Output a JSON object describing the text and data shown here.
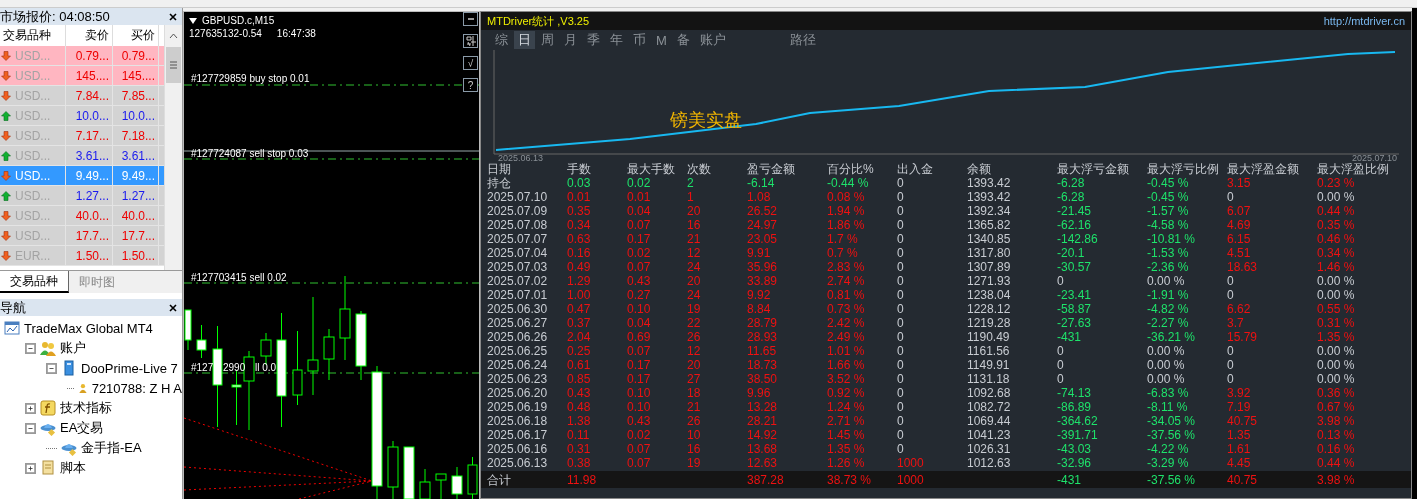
{
  "market_watch": {
    "title": "市场报价: 04:08:50",
    "columns": [
      "交易品种",
      "卖价",
      "买价"
    ],
    "rows": [
      {
        "symbol": "USD...",
        "bid": "0.79...",
        "ask": "0.79...",
        "rising": false,
        "highlighted": true,
        "selected": false
      },
      {
        "symbol": "USD...",
        "bid": "145....",
        "ask": "145....",
        "rising": false,
        "highlighted": true,
        "selected": false
      },
      {
        "symbol": "USD...",
        "bid": "7.84...",
        "ask": "7.85...",
        "rising": false,
        "highlighted": false,
        "selected": false
      },
      {
        "symbol": "USD...",
        "bid": "10.0...",
        "ask": "10.0...",
        "rising": true,
        "highlighted": false,
        "selected": false
      },
      {
        "symbol": "USD...",
        "bid": "7.17...",
        "ask": "7.18...",
        "rising": false,
        "highlighted": false,
        "selected": false
      },
      {
        "symbol": "USD...",
        "bid": "3.61...",
        "ask": "3.61...",
        "rising": true,
        "highlighted": false,
        "selected": false
      },
      {
        "symbol": "USD...",
        "bid": "9.49...",
        "ask": "9.49...",
        "rising": false,
        "highlighted": false,
        "selected": true
      },
      {
        "symbol": "USD...",
        "bid": "1.27...",
        "ask": "1.27...",
        "rising": true,
        "highlighted": false,
        "selected": false
      },
      {
        "symbol": "USD...",
        "bid": "40.0...",
        "ask": "40.0...",
        "rising": false,
        "highlighted": false,
        "selected": false
      },
      {
        "symbol": "USD...",
        "bid": "17.7...",
        "ask": "17.7...",
        "rising": false,
        "highlighted": false,
        "selected": false
      },
      {
        "symbol": "EUR...",
        "bid": "1.50...",
        "ask": "1.50...",
        "rising": false,
        "highlighted": false,
        "selected": false
      }
    ],
    "tabs": [
      {
        "label": "交易品种",
        "selected": true
      },
      {
        "label": "即时图",
        "selected": false
      }
    ]
  },
  "navigator": {
    "title": "导航",
    "tree": [
      {
        "label": "TradeMax Global MT4",
        "kind": "terminal",
        "children": [
          {
            "label": "账户",
            "kind": "accounts",
            "expanded": true,
            "children": [
              {
                "label": "DooPrime-Live 7",
                "kind": "server",
                "expanded": true,
                "children": [
                  {
                    "label": "7210788: Z H A",
                    "kind": "account"
                  }
                ]
              }
            ]
          },
          {
            "label": "技术指标",
            "kind": "indicators",
            "expanded": false
          },
          {
            "label": "EA交易",
            "kind": "experts",
            "expanded": true,
            "children": [
              {
                "label": "金手指-EA",
                "kind": "expert"
              }
            ]
          },
          {
            "label": "脚本",
            "kind": "scripts",
            "expanded": false
          }
        ]
      }
    ]
  },
  "chart": {
    "symbol": "GBPUSD.c,M15",
    "info": [
      "127635132-0.54",
      "16:47:38"
    ],
    "buttons": [
      "√",
      "?"
    ],
    "orders": [
      {
        "parts": [
          "#127729859 buy stop 0.01"
        ]
      },
      {
        "parts": [
          "#127724087 sell stop 0.03"
        ]
      },
      {
        "parts": [
          "#127703415 sell 0.02"
        ]
      },
      {
        "parts": [
          "#127",
          "2990",
          "ll 0.0"
        ]
      }
    ]
  },
  "stats": {
    "title": "MTDriver统计 ,V3.25",
    "link": "http://mtdriver.cn",
    "tabs": [
      {
        "label": "综",
        "selected": false
      },
      {
        "label": "日",
        "selected": true
      },
      {
        "label": "周",
        "selected": false
      },
      {
        "label": "月",
        "selected": false
      },
      {
        "label": "季",
        "selected": false
      },
      {
        "label": "年",
        "selected": false
      },
      {
        "label": "币",
        "selected": false
      },
      {
        "label": "M",
        "selected": false
      },
      {
        "label": "备",
        "selected": false
      },
      {
        "label": "账户",
        "selected": false
      },
      {
        "label": "路径",
        "selected": false
      }
    ],
    "equity": {
      "label": "镑美实盘",
      "start": "2025.06.13",
      "end": "2025.07.10"
    },
    "columns": [
      "日期",
      "手数",
      "最大手数",
      "次数",
      "盈亏金额",
      "百分比%",
      "出入金",
      "余额",
      "最大浮亏金额",
      "最大浮亏比例",
      "最大浮盈金额",
      "最大浮盈比例"
    ],
    "rows": [
      [
        {
          "text": "持仓"
        },
        {
          "text": "0.03",
          "color": "#1ee36b"
        },
        {
          "text": "0.02",
          "color": "#1ee36b"
        },
        {
          "text": "2",
          "color": "#1ee36b"
        },
        {
          "text": "-6.14",
          "color": "#1ee36b"
        },
        {
          "text": "-0.44 %",
          "color": "#1ee36b"
        },
        {
          "text": "0",
          "color": "#c8ccd2"
        },
        {
          "text": "1393.42",
          "color": "#c8ccd2"
        },
        {
          "text": "-6.28",
          "color": "#1ee36b"
        },
        {
          "text": "-0.45 %",
          "color": "#1ee36b"
        },
        {
          "text": "3.15",
          "color": "#ee1111"
        },
        {
          "text": "0.23 %",
          "color": "#ee1111"
        }
      ],
      [
        {
          "text": "2025.07.10",
          "color": "#c8ccd2"
        },
        {
          "text": "0.01",
          "color": "#ee1111"
        },
        {
          "text": "0.01",
          "color": "#ee1111"
        },
        {
          "text": "1",
          "color": "#ee1111"
        },
        {
          "text": "1.08",
          "color": "#ee1111"
        },
        {
          "text": "0.08 %",
          "color": "#ee1111"
        },
        {
          "text": "0",
          "color": "#c8ccd2"
        },
        {
          "text": "1393.42",
          "color": "#c8ccd2"
        },
        {
          "text": "-6.28",
          "color": "#1ee36b"
        },
        {
          "text": "-0.45 %",
          "color": "#1ee36b"
        },
        {
          "text": "0",
          "color": "#c8ccd2"
        },
        {
          "text": "0.00 %",
          "color": "#c8ccd2"
        }
      ],
      [
        {
          "text": "2025.07.09",
          "color": "#c8ccd2"
        },
        {
          "text": "0.35",
          "color": "#ee1111"
        },
        {
          "text": "0.04",
          "color": "#ee1111"
        },
        {
          "text": "20",
          "color": "#ee1111"
        },
        {
          "text": "26.52",
          "color": "#ee1111"
        },
        {
          "text": "1.94 %",
          "color": "#ee1111"
        },
        {
          "text": "0",
          "color": "#c8ccd2"
        },
        {
          "text": "1392.34",
          "color": "#c8ccd2"
        },
        {
          "text": "-21.45",
          "color": "#1ee36b"
        },
        {
          "text": "-1.57 %",
          "color": "#1ee36b"
        },
        {
          "text": "6.07",
          "color": "#ee1111"
        },
        {
          "text": "0.44 %",
          "color": "#ee1111"
        }
      ],
      [
        {
          "text": "2025.07.08",
          "color": "#c8ccd2"
        },
        {
          "text": "0.34",
          "color": "#ee1111"
        },
        {
          "text": "0.07",
          "color": "#ee1111"
        },
        {
          "text": "16",
          "color": "#ee1111"
        },
        {
          "text": "24.97",
          "color": "#ee1111"
        },
        {
          "text": "1.86 %",
          "color": "#ee1111"
        },
        {
          "text": "0",
          "color": "#c8ccd2"
        },
        {
          "text": "1365.82",
          "color": "#c8ccd2"
        },
        {
          "text": "-62.16",
          "color": "#1ee36b"
        },
        {
          "text": "-4.58 %",
          "color": "#1ee36b"
        },
        {
          "text": "4.69",
          "color": "#ee1111"
        },
        {
          "text": "0.35 %",
          "color": "#ee1111"
        }
      ],
      [
        {
          "text": "2025.07.07",
          "color": "#c8ccd2"
        },
        {
          "text": "0.63",
          "color": "#ee1111"
        },
        {
          "text": "0.17",
          "color": "#ee1111"
        },
        {
          "text": "21",
          "color": "#ee1111"
        },
        {
          "text": "23.05",
          "color": "#ee1111"
        },
        {
          "text": "1.7 %",
          "color": "#ee1111"
        },
        {
          "text": "0",
          "color": "#c8ccd2"
        },
        {
          "text": "1340.85",
          "color": "#c8ccd2"
        },
        {
          "text": "-142.86",
          "color": "#1ee36b"
        },
        {
          "text": "-10.81 %",
          "color": "#1ee36b"
        },
        {
          "text": "6.15",
          "color": "#ee1111"
        },
        {
          "text": "0.46 %",
          "color": "#ee1111"
        }
      ],
      [
        {
          "text": "2025.07.04",
          "color": "#c8ccd2"
        },
        {
          "text": "0.16",
          "color": "#ee1111"
        },
        {
          "text": "0.02",
          "color": "#ee1111"
        },
        {
          "text": "12",
          "color": "#ee1111"
        },
        {
          "text": "9.91",
          "color": "#ee1111"
        },
        {
          "text": "0.7 %",
          "color": "#ee1111"
        },
        {
          "text": "0",
          "color": "#c8ccd2"
        },
        {
          "text": "1317.80",
          "color": "#c8ccd2"
        },
        {
          "text": "-20.1",
          "color": "#1ee36b"
        },
        {
          "text": "-1.53 %",
          "color": "#1ee36b"
        },
        {
          "text": "4.51",
          "color": "#ee1111"
        },
        {
          "text": "0.34 %",
          "color": "#ee1111"
        }
      ],
      [
        {
          "text": "2025.07.03",
          "color": "#c8ccd2"
        },
        {
          "text": "0.49",
          "color": "#ee1111"
        },
        {
          "text": "0.07",
          "color": "#ee1111"
        },
        {
          "text": "24",
          "color": "#ee1111"
        },
        {
          "text": "35.96",
          "color": "#ee1111"
        },
        {
          "text": "2.83 %",
          "color": "#ee1111"
        },
        {
          "text": "0",
          "color": "#c8ccd2"
        },
        {
          "text": "1307.89",
          "color": "#c8ccd2"
        },
        {
          "text": "-30.57",
          "color": "#1ee36b"
        },
        {
          "text": "-2.36 %",
          "color": "#1ee36b"
        },
        {
          "text": "18.63",
          "color": "#ee1111"
        },
        {
          "text": "1.46 %",
          "color": "#ee1111"
        }
      ],
      [
        {
          "text": "2025.07.02",
          "color": "#c8ccd2"
        },
        {
          "text": "1.29",
          "color": "#ee1111"
        },
        {
          "text": "0.43",
          "color": "#ee1111"
        },
        {
          "text": "20",
          "color": "#ee1111"
        },
        {
          "text": "33.89",
          "color": "#ee1111"
        },
        {
          "text": "2.74 %",
          "color": "#ee1111"
        },
        {
          "text": "0",
          "color": "#c8ccd2"
        },
        {
          "text": "1271.93",
          "color": "#c8ccd2"
        },
        {
          "text": "0",
          "color": "#c8ccd2"
        },
        {
          "text": "0.00 %",
          "color": "#c8ccd2"
        },
        {
          "text": "0",
          "color": "#c8ccd2"
        },
        {
          "text": "0.00 %",
          "color": "#c8ccd2"
        }
      ],
      [
        {
          "text": "2025.07.01",
          "color": "#c8ccd2"
        },
        {
          "text": "1.00",
          "color": "#ee1111"
        },
        {
          "text": "0.27",
          "color": "#ee1111"
        },
        {
          "text": "24",
          "color": "#ee1111"
        },
        {
          "text": "9.92",
          "color": "#ee1111"
        },
        {
          "text": "0.81 %",
          "color": "#ee1111"
        },
        {
          "text": "0",
          "color": "#c8ccd2"
        },
        {
          "text": "1238.04",
          "color": "#c8ccd2"
        },
        {
          "text": "-23.41",
          "color": "#1ee36b"
        },
        {
          "text": "-1.91 %",
          "color": "#1ee36b"
        },
        {
          "text": "0",
          "color": "#c8ccd2"
        },
        {
          "text": "0.00 %",
          "color": "#c8ccd2"
        }
      ],
      [
        {
          "text": "2025.06.30",
          "color": "#c8ccd2"
        },
        {
          "text": "0.47",
          "color": "#ee1111"
        },
        {
          "text": "0.10",
          "color": "#ee1111"
        },
        {
          "text": "19",
          "color": "#ee1111"
        },
        {
          "text": "8.84",
          "color": "#ee1111"
        },
        {
          "text": "0.73 %",
          "color": "#ee1111"
        },
        {
          "text": "0",
          "color": "#c8ccd2"
        },
        {
          "text": "1228.12",
          "color": "#c8ccd2"
        },
        {
          "text": "-58.87",
          "color": "#1ee36b"
        },
        {
          "text": "-4.82 %",
          "color": "#1ee36b"
        },
        {
          "text": "6.62",
          "color": "#ee1111"
        },
        {
          "text": "0.55 %",
          "color": "#ee1111"
        }
      ],
      [
        {
          "text": "2025.06.27",
          "color": "#c8ccd2"
        },
        {
          "text": "0.37",
          "color": "#ee1111"
        },
        {
          "text": "0.04",
          "color": "#ee1111"
        },
        {
          "text": "22",
          "color": "#ee1111"
        },
        {
          "text": "28.79",
          "color": "#ee1111"
        },
        {
          "text": "2.42 %",
          "color": "#ee1111"
        },
        {
          "text": "0",
          "color": "#c8ccd2"
        },
        {
          "text": "1219.28",
          "color": "#c8ccd2"
        },
        {
          "text": "-27.63",
          "color": "#1ee36b"
        },
        {
          "text": "-2.27 %",
          "color": "#1ee36b"
        },
        {
          "text": "3.7",
          "color": "#ee1111"
        },
        {
          "text": "0.31 %",
          "color": "#ee1111"
        }
      ],
      [
        {
          "text": "2025.06.26",
          "color": "#c8ccd2"
        },
        {
          "text": "2.04",
          "color": "#ee1111"
        },
        {
          "text": "0.69",
          "color": "#ee1111"
        },
        {
          "text": "26",
          "color": "#ee1111"
        },
        {
          "text": "28.93",
          "color": "#ee1111"
        },
        {
          "text": "2.49 %",
          "color": "#ee1111"
        },
        {
          "text": "0",
          "color": "#c8ccd2"
        },
        {
          "text": "1190.49",
          "color": "#c8ccd2"
        },
        {
          "text": "-431",
          "color": "#1ee36b"
        },
        {
          "text": "-36.21 %",
          "color": "#1ee36b"
        },
        {
          "text": "15.79",
          "color": "#ee1111"
        },
        {
          "text": "1.35 %",
          "color": "#ee1111"
        }
      ],
      [
        {
          "text": "2025.06.25",
          "color": "#c8ccd2"
        },
        {
          "text": "0.25",
          "color": "#ee1111"
        },
        {
          "text": "0.07",
          "color": "#ee1111"
        },
        {
          "text": "12",
          "color": "#ee1111"
        },
        {
          "text": "11.65",
          "color": "#ee1111"
        },
        {
          "text": "1.01 %",
          "color": "#ee1111"
        },
        {
          "text": "0",
          "color": "#c8ccd2"
        },
        {
          "text": "1161.56",
          "color": "#c8ccd2"
        },
        {
          "text": "0",
          "color": "#c8ccd2"
        },
        {
          "text": "0.00 %",
          "color": "#c8ccd2"
        },
        {
          "text": "0",
          "color": "#c8ccd2"
        },
        {
          "text": "0.00 %",
          "color": "#c8ccd2"
        }
      ],
      [
        {
          "text": "2025.06.24",
          "color": "#c8ccd2"
        },
        {
          "text": "0.61",
          "color": "#ee1111"
        },
        {
          "text": "0.17",
          "color": "#ee1111"
        },
        {
          "text": "20",
          "color": "#ee1111"
        },
        {
          "text": "18.73",
          "color": "#ee1111"
        },
        {
          "text": "1.66 %",
          "color": "#ee1111"
        },
        {
          "text": "0",
          "color": "#c8ccd2"
        },
        {
          "text": "1149.91",
          "color": "#c8ccd2"
        },
        {
          "text": "0",
          "color": "#c8ccd2"
        },
        {
          "text": "0.00 %",
          "color": "#c8ccd2"
        },
        {
          "text": "0",
          "color": "#c8ccd2"
        },
        {
          "text": "0.00 %",
          "color": "#c8ccd2"
        }
      ],
      [
        {
          "text": "2025.06.23",
          "color": "#c8ccd2"
        },
        {
          "text": "0.85",
          "color": "#ee1111"
        },
        {
          "text": "0.17",
          "color": "#ee1111"
        },
        {
          "text": "27",
          "color": "#ee1111"
        },
        {
          "text": "38.50",
          "color": "#ee1111"
        },
        {
          "text": "3.52 %",
          "color": "#ee1111"
        },
        {
          "text": "0",
          "color": "#c8ccd2"
        },
        {
          "text": "1131.18",
          "color": "#c8ccd2"
        },
        {
          "text": "0",
          "color": "#c8ccd2"
        },
        {
          "text": "0.00 %",
          "color": "#c8ccd2"
        },
        {
          "text": "0",
          "color": "#c8ccd2"
        },
        {
          "text": "0.00 %",
          "color": "#c8ccd2"
        }
      ],
      [
        {
          "text": "2025.06.20",
          "color": "#c8ccd2"
        },
        {
          "text": "0.43",
          "color": "#ee1111"
        },
        {
          "text": "0.10",
          "color": "#ee1111"
        },
        {
          "text": "18",
          "color": "#ee1111"
        },
        {
          "text": "9.96",
          "color": "#ee1111"
        },
        {
          "text": "0.92 %",
          "color": "#ee1111"
        },
        {
          "text": "0",
          "color": "#c8ccd2"
        },
        {
          "text": "1092.68",
          "color": "#c8ccd2"
        },
        {
          "text": "-74.13",
          "color": "#1ee36b"
        },
        {
          "text": "-6.83 %",
          "color": "#1ee36b"
        },
        {
          "text": "3.92",
          "color": "#ee1111"
        },
        {
          "text": "0.36 %",
          "color": "#ee1111"
        }
      ],
      [
        {
          "text": "2025.06.19",
          "color": "#c8ccd2"
        },
        {
          "text": "0.48",
          "color": "#ee1111"
        },
        {
          "text": "0.10",
          "color": "#ee1111"
        },
        {
          "text": "21",
          "color": "#ee1111"
        },
        {
          "text": "13.28",
          "color": "#ee1111"
        },
        {
          "text": "1.24 %",
          "color": "#ee1111"
        },
        {
          "text": "0",
          "color": "#c8ccd2"
        },
        {
          "text": "1082.72",
          "color": "#c8ccd2"
        },
        {
          "text": "-86.89",
          "color": "#1ee36b"
        },
        {
          "text": "-8.11 %",
          "color": "#1ee36b"
        },
        {
          "text": "7.19",
          "color": "#ee1111"
        },
        {
          "text": "0.67 %",
          "color": "#ee1111"
        }
      ],
      [
        {
          "text": "2025.06.18",
          "color": "#c8ccd2"
        },
        {
          "text": "1.38",
          "color": "#ee1111"
        },
        {
          "text": "0.43",
          "color": "#ee1111"
        },
        {
          "text": "26",
          "color": "#ee1111"
        },
        {
          "text": "28.21",
          "color": "#ee1111"
        },
        {
          "text": "2.71 %",
          "color": "#ee1111"
        },
        {
          "text": "0",
          "color": "#c8ccd2"
        },
        {
          "text": "1069.44",
          "color": "#c8ccd2"
        },
        {
          "text": "-364.62",
          "color": "#1ee36b"
        },
        {
          "text": "-34.05 %",
          "color": "#1ee36b"
        },
        {
          "text": "40.75",
          "color": "#ee1111"
        },
        {
          "text": "3.98 %",
          "color": "#ee1111"
        }
      ],
      [
        {
          "text": "2025.06.17",
          "color": "#c8ccd2"
        },
        {
          "text": "0.11",
          "color": "#ee1111"
        },
        {
          "text": "0.02",
          "color": "#ee1111"
        },
        {
          "text": "10",
          "color": "#ee1111"
        },
        {
          "text": "14.92",
          "color": "#ee1111"
        },
        {
          "text": "1.45 %",
          "color": "#ee1111"
        },
        {
          "text": "0",
          "color": "#c8ccd2"
        },
        {
          "text": "1041.23",
          "color": "#c8ccd2"
        },
        {
          "text": "-391.71",
          "color": "#1ee36b"
        },
        {
          "text": "-37.56 %",
          "color": "#1ee36b"
        },
        {
          "text": "1.35",
          "color": "#ee1111"
        },
        {
          "text": "0.13 %",
          "color": "#ee1111"
        }
      ],
      [
        {
          "text": "2025.06.16",
          "color": "#c8ccd2"
        },
        {
          "text": "0.31",
          "color": "#ee1111"
        },
        {
          "text": "0.07",
          "color": "#ee1111"
        },
        {
          "text": "16",
          "color": "#ee1111"
        },
        {
          "text": "13.68",
          "color": "#ee1111"
        },
        {
          "text": "1.35 %",
          "color": "#ee1111"
        },
        {
          "text": "0",
          "color": "#c8ccd2"
        },
        {
          "text": "1026.31",
          "color": "#c8ccd2"
        },
        {
          "text": "-43.03",
          "color": "#1ee36b"
        },
        {
          "text": "-4.22 %",
          "color": "#1ee36b"
        },
        {
          "text": "1.61",
          "color": "#ee1111"
        },
        {
          "text": "0.16 %",
          "color": "#ee1111"
        }
      ],
      [
        {
          "text": "2025.06.13",
          "color": "#c8ccd2"
        },
        {
          "text": "0.38",
          "color": "#ee1111"
        },
        {
          "text": "0.07",
          "color": "#ee1111"
        },
        {
          "text": "19",
          "color": "#ee1111"
        },
        {
          "text": "12.63",
          "color": "#ee1111"
        },
        {
          "text": "1.26 %",
          "color": "#ee1111"
        },
        {
          "text": "1000",
          "color": "#ee1111"
        },
        {
          "text": "1012.63",
          "color": "#c8ccd2"
        },
        {
          "text": "-32.96",
          "color": "#1ee36b"
        },
        {
          "text": "-3.29 %",
          "color": "#1ee36b"
        },
        {
          "text": "4.45",
          "color": "#ee1111"
        },
        {
          "text": "0.44 %",
          "color": "#ee1111"
        }
      ]
    ],
    "total": {
      "label": {
        "text": "合计"
      },
      "lots": {
        "text": "11.98",
        "color": "#ee1111"
      },
      "profit": {
        "text": "387.28",
        "color": "#ee1111"
      },
      "percent": {
        "text": "38.73 %",
        "color": "#ee1111"
      },
      "deposit": {
        "text": "1000",
        "color": "#ee1111"
      },
      "max_float_loss": {
        "text": "-431",
        "color": "#1ee36b"
      },
      "max_float_loss_pct": {
        "text": "-37.56 %",
        "color": "#1ee36b"
      },
      "max_float_profit": {
        "text": "40.75",
        "color": "#ee1111"
      },
      "max_float_profit_pct": {
        "text": "3.98 %",
        "color": "#ee1111"
      }
    }
  }
}
